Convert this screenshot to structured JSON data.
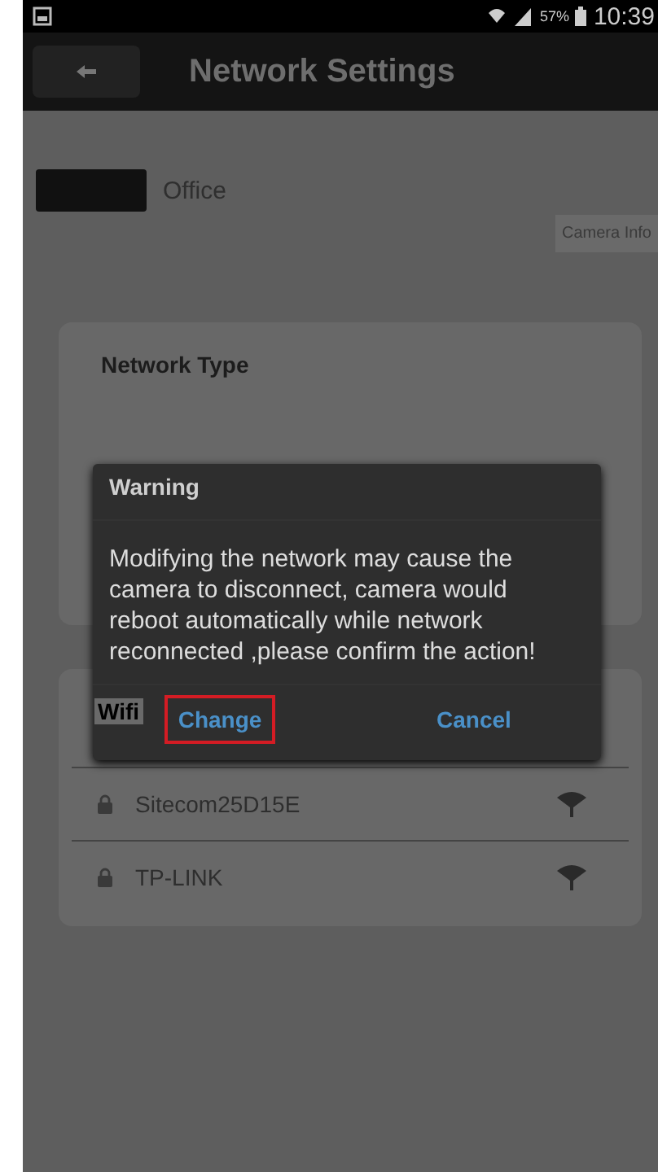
{
  "status_bar": {
    "battery": "57%",
    "time": "10:39"
  },
  "header": {
    "title": "Network Settings"
  },
  "camera": {
    "name": "Office",
    "info_button": "Camera Info"
  },
  "network_type": {
    "title": "Network Type"
  },
  "wifi": {
    "title": "Wifi",
    "networks": [
      {
        "name": "Sitecom25D15E",
        "locked": true
      },
      {
        "name": "TP-LINK",
        "locked": true
      }
    ]
  },
  "dialog": {
    "title": "Warning",
    "message": "Modifying the network may cause the camera to disconnect, camera would reboot automatically while network reconnected ,please confirm the action!",
    "buttons": [
      {
        "label": "Change",
        "highlighted": true
      },
      {
        "label": "Cancel",
        "highlighted": false
      }
    ]
  }
}
